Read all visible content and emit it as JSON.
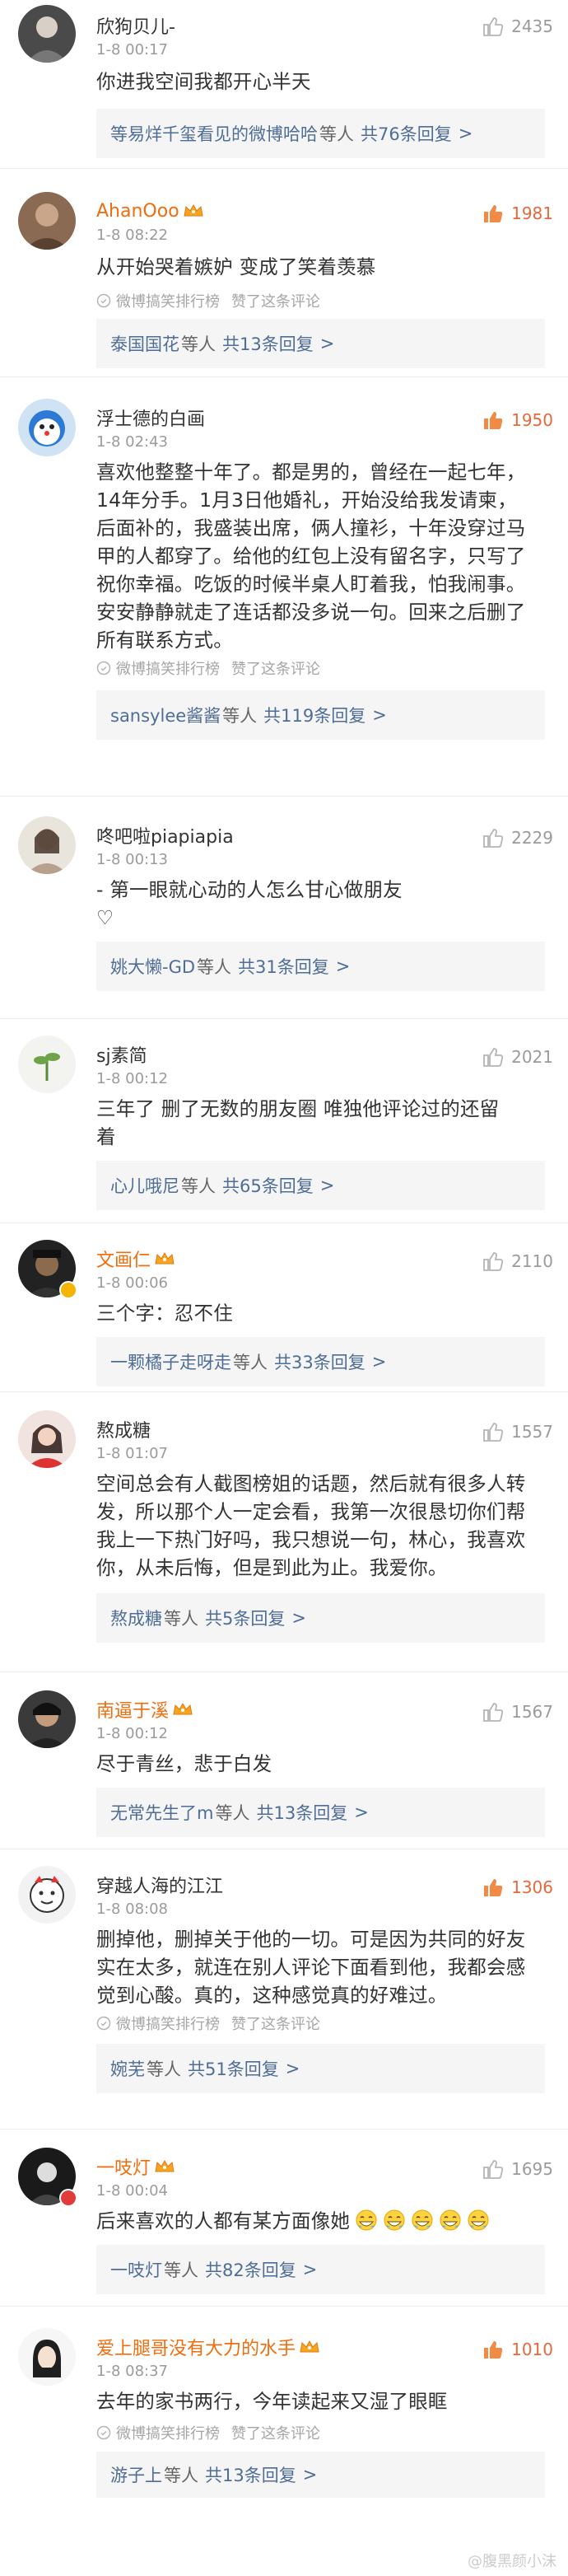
{
  "colors": {
    "accent_orange": "#f06d0e",
    "link_blue": "#4e6d97",
    "hot_like": "#e6683c"
  },
  "icons": {
    "like": "thumbs-up-icon",
    "crown": "crown-icon",
    "rank": "ranking-icon",
    "emoji": "face-emoji-icon",
    "verified": "verified-badge-icon"
  },
  "comments": [
    {
      "user": "欣狗贝儿-",
      "time": "1-8 00:17",
      "likes": "2435",
      "lines": [
        "你进我空间我都开心半天"
      ],
      "reply_who": "等易烊千玺看见的微博哈哈",
      "reply_etc": "等人",
      "reply_count": "共76条回复",
      "reply_arrow": ">"
    },
    {
      "user": "AhanOoo",
      "time": "1-8 08:22",
      "likes": "1981",
      "lines": [
        "从开始哭着嫉妒 变成了笑着羡慕"
      ],
      "meta_rank": "微博搞笑排行榜",
      "meta_liked": "赞了这条评论",
      "reply_who": "泰国国花",
      "reply_etc": "等人",
      "reply_count": "共13条回复",
      "reply_arrow": ">"
    },
    {
      "user": "浮士德的白画",
      "time": "1-8 02:43",
      "likes": "1950",
      "lines": [
        "喜欢他整整十年了。都是男的，曾经在一起七年，",
        "14年分手。1月3日他婚礼，开始没给我发请柬，",
        "后面补的，我盛装出席，俩人撞衫，十年没穿过马",
        "甲的人都穿了。给他的红包上没有留名字，只写了",
        "祝你幸福。吃饭的时候半桌人盯着我，怕我闹事。",
        "安安静静就走了连话都没多说一句。回来之后删了",
        "所有联系方式。"
      ],
      "meta_rank": "微博搞笑排行榜",
      "meta_liked": "赞了这条评论",
      "reply_who": "sansylee酱酱",
      "reply_etc": "等人",
      "reply_count": "共119条回复",
      "reply_arrow": ">"
    },
    {
      "user": "咚吧啦piapiapia",
      "time": "1-8 00:13",
      "likes": "2229",
      "lines": [
        "- 第一眼就心动的人怎么甘心做朋友",
        "♡"
      ],
      "reply_who": "姚大懒-GD",
      "reply_etc": "等人",
      "reply_count": "共31条回复",
      "reply_arrow": ">"
    },
    {
      "user": "sj素简",
      "time": "1-8 00:12",
      "likes": "2021",
      "lines": [
        "三年了 删了无数的朋友圈 唯独他评论过的还留",
        "着"
      ],
      "reply_who": "心儿哦尼",
      "reply_etc": "等人",
      "reply_count": "共65条回复",
      "reply_arrow": ">"
    },
    {
      "user": "文画仁",
      "time": "1-8 00:06",
      "likes": "2110",
      "lines": [
        "三个字：忍不住"
      ],
      "reply_who": "一颗橘子走呀走",
      "reply_etc": "等人",
      "reply_count": "共33条回复",
      "reply_arrow": ">"
    },
    {
      "user": "熬成糖",
      "time": "1-8 01:07",
      "likes": "1557",
      "lines": [
        "空间总会有人截图榜姐的话题，然后就有很多人转",
        "发，所以那个人一定会看，我第一次很恳切你们帮",
        "我上一下热门好吗，我只想说一句，林心，我喜欢",
        "你，从未后悔，但是到此为止。我爱你。"
      ],
      "reply_who": "熬成糖",
      "reply_etc": "等人",
      "reply_count": "共5条回复",
      "reply_arrow": ">"
    },
    {
      "user": "南逼于溪",
      "time": "1-8 00:12",
      "likes": "1567",
      "lines": [
        "尽于青丝，悲于白发"
      ],
      "reply_who": "无常先生了m",
      "reply_etc": "等人",
      "reply_count": "共13条回复",
      "reply_arrow": ">"
    },
    {
      "user": "穿越人海的江江",
      "time": "1-8 08:08",
      "likes": "1306",
      "lines": [
        "删掉他，删掉关于他的一切。可是因为共同的好友",
        "实在太多，就连在别人评论下面看到他，我都会感",
        "觉到心酸。真的，这种感觉真的好难过。"
      ],
      "meta_rank": "微博搞笑排行榜",
      "meta_liked": "赞了这条评论",
      "reply_who": "婉芜",
      "reply_etc": "等人",
      "reply_count": "共51条回复",
      "reply_arrow": ">"
    },
    {
      "user": "一吱灯",
      "time": "1-8 00:04",
      "likes": "1695",
      "lines": [
        "后来喜欢的人都有某方面像她"
      ],
      "emoji_count": 5,
      "reply_who": "一吱灯",
      "reply_etc": "等人",
      "reply_count": "共82条回复",
      "reply_arrow": ">"
    },
    {
      "user": "爱上腿哥没有大力的水手",
      "time": "1-8 08:37",
      "likes": "1010",
      "lines": [
        "去年的家书两行，今年读起来又湿了眼眶"
      ],
      "meta_rank": "微博搞笑排行榜",
      "meta_liked": "赞了这条评论",
      "reply_who": "游子上",
      "reply_etc": "等人",
      "reply_count": "共13条回复",
      "reply_arrow": ">"
    }
  ],
  "watermark": "@腹黑颜小沫"
}
